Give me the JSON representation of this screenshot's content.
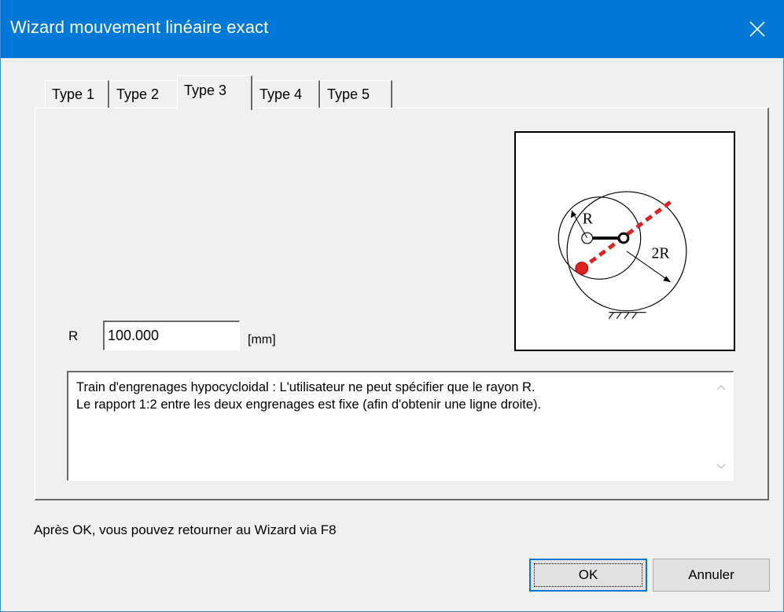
{
  "window": {
    "title": "Wizard mouvement linéaire exact",
    "close_icon": "close-icon"
  },
  "tabs": [
    {
      "label": "Type 1",
      "active": false
    },
    {
      "label": "Type 2",
      "active": false
    },
    {
      "label": "Type 3",
      "active": true
    },
    {
      "label": "Type 4",
      "active": false
    },
    {
      "label": "Type 5",
      "active": false
    }
  ],
  "diagram": {
    "label_r": "R",
    "label_2r": "2R",
    "accent_red": "#dd2222"
  },
  "form": {
    "r_label": "R",
    "r_value": "100.000",
    "unit": "[mm]"
  },
  "description": {
    "line1": "Train d'engrenages hypocycloidal : L'utilisateur ne peut spécifier que le rayon R.",
    "line2": "Le rapport 1:2 entre les deux engrenages est fixe (afin d'obtenir une ligne droite)."
  },
  "footer": {
    "hint": "Après OK, vous pouvez retourner au Wizard via F8",
    "ok_label": "OK",
    "cancel_label": "Annuler"
  }
}
